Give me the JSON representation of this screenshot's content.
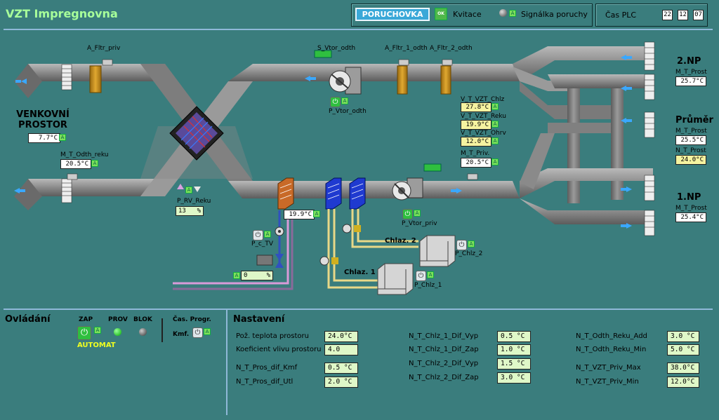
{
  "app_title": "VZT Impregnovna",
  "header": {
    "alarm_button": "PORUCHOVKA",
    "ack_icon_text": "OK",
    "ack_label": "Kvitace",
    "fault_label": "Signálka poruchy",
    "plc_time_label": "Čas PLC",
    "plc_time": {
      "hh": "22",
      "mm": "12",
      "ss": "07"
    }
  },
  "schema": {
    "outside_label": "VENKOVNÍ PROSTOR",
    "outside_temp": "7.7°C",
    "m_t_odth_reku_label": "M_T_Odth_reku",
    "m_t_odth_reku_val": "20.5°C",
    "a_fltr_priv": "A_Fltr_priv",
    "s_vtor_odth": "S_Vtor_odth",
    "a_fltr_1_odth": "A_Fltr_1_odth",
    "a_fltr_2_odth": "A_Fltr_2_odth",
    "p_vtor_odth": "P_Vtor_odth",
    "v_t_vzt_chlz_label": "V_T_VZT_Chlz",
    "v_t_vzt_chlz_val": "27.8°C",
    "v_t_vzt_reku_label": "V_T_VZT_Reku",
    "v_t_vzt_reku_val": "19.9°C",
    "v_t_vzt_ohrv_label": "V_T_VZT_Ohrv",
    "v_t_vzt_ohrv_val": "12.0°C",
    "m_t_priv_label": "M_T_Priv.",
    "m_t_priv_val": "20.5°C",
    "p_rv_reku_label": "P_RV_Reku",
    "p_rv_reku_val": "13",
    "p_rv_reku_unit": "%",
    "heater_temp": "19.9°C",
    "p_c_tv": "P_c_TV",
    "valve_val": "0",
    "valve_unit": "%",
    "p_vtor_priv": "P_Vtor_priv",
    "chlaz1": "Chlaz. 1",
    "chlaz2": "Chlaz. 2",
    "p_chlz_1": "P_Chlz_1",
    "p_chlz_2": "P_Chlz_2",
    "np2": "2.NP",
    "np2_label": "M_T_Prost",
    "np2_val": "25.7°C",
    "prumer": "Průměr",
    "prumer_label": "M_T_Prost",
    "prumer_val": "25.5°C",
    "n_t_prost_label": "N_T_Prost",
    "n_t_prost_val": "24.0°C",
    "np1": "1.NP",
    "np1_label": "M_T_Prost",
    "np1_val": "25.4°C"
  },
  "control": {
    "title": "Ovládání",
    "zap": "ZAP",
    "prov": "PROV",
    "blok": "BLOK",
    "cas_progr": "Čas. Progr.",
    "kmf": "Kmf.",
    "automat": "AUTOMAT"
  },
  "settings": {
    "title": "Nastavení",
    "col1": [
      {
        "label": "Pož. teplota prostoru",
        "value": "24.0°C"
      },
      {
        "label": "Koeficient vlivu prostoru",
        "value": "4.0"
      },
      {
        "label": "N_T_Pros_dif_Kmf",
        "value": "0.5 °C"
      },
      {
        "label": "N_T_Pros_dif_Utl",
        "value": "2.0 °C"
      }
    ],
    "col2": [
      {
        "label": "N_T_Chlz_1_Dif_Vyp",
        "value": "0.5 °C"
      },
      {
        "label": "N_T_Chlz_1_Dif_Zap",
        "value": "1.0 °C"
      },
      {
        "label": "N_T_Chlz_2_Dif_Vyp",
        "value": "1.5 °C"
      },
      {
        "label": "N_T_Chlz_2_Dif_Zap",
        "value": "3.0 °C"
      }
    ],
    "col3": [
      {
        "label": "N_T_Odth_Reku_Add",
        "value": "3.0 °C"
      },
      {
        "label": "N_T_Odth_Reku_Min",
        "value": "5.0 °C"
      },
      {
        "label": "N_T_VZT_Priv_Max",
        "value": "38.0°C"
      },
      {
        "label": "N_T_VZT_Priv_Min",
        "value": "12.0°C"
      }
    ]
  },
  "colors": {
    "background": "#3a7d7d",
    "title": "#a8ff9a",
    "duct": "#8e8e8e",
    "alarm": "#3aa8d8",
    "filter": "#c8901a"
  },
  "icons": [
    "power-icon",
    "ok-icon",
    "fan-icon",
    "filter-icon",
    "arrow-icon",
    "valve-icon",
    "pump-icon",
    "cooler-icon",
    "heat-exchanger-icon"
  ]
}
